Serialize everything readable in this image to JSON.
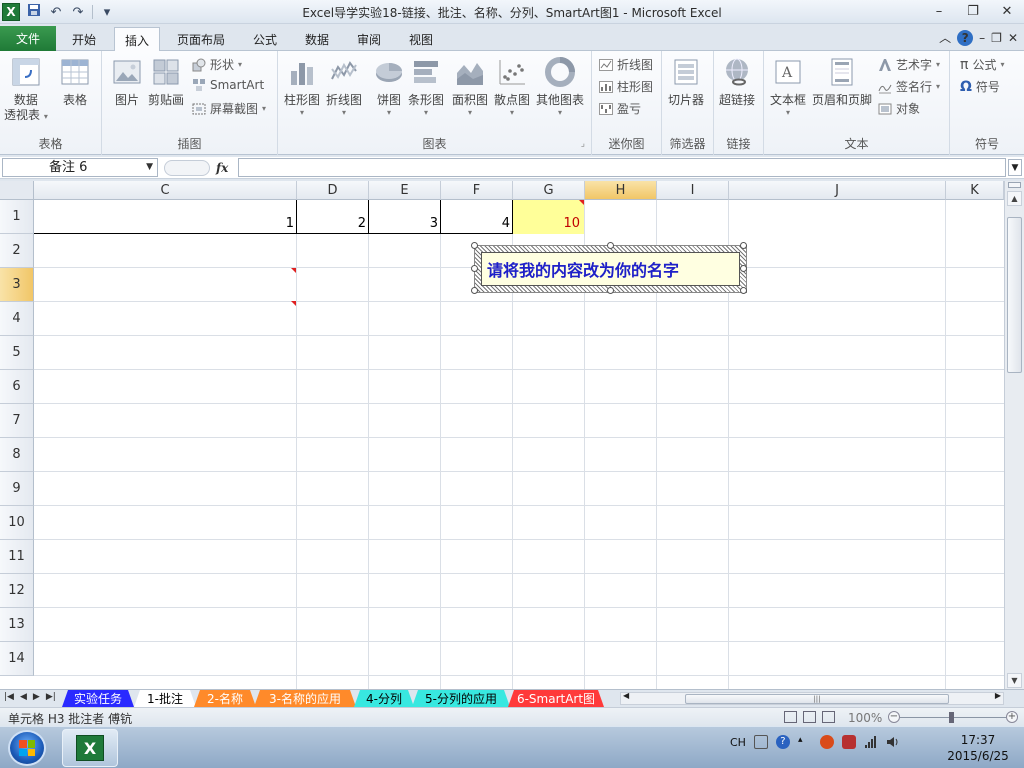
{
  "window": {
    "title": "Excel导学实验18-链接、批注、名称、分列、SmartArt图1 - Microsoft Excel",
    "app_icon": "X"
  },
  "quick_access": {
    "save_icon": "save-icon",
    "undo_icon": "undo-icon",
    "redo_icon": "redo-icon",
    "customize_icon": "customize-icon"
  },
  "ribbon_tabs": {
    "file": "文件",
    "items": [
      "开始",
      "插入",
      "页面布局",
      "公式",
      "数据",
      "审阅",
      "视图"
    ],
    "active": "插入"
  },
  "ribbon": {
    "groups": {
      "tables": "表格",
      "illustrations": "插图",
      "charts": "图表",
      "sparklines": "迷你图",
      "filter": "筛选器",
      "links": "链接",
      "text": "文本",
      "symbols": "符号"
    },
    "buttons": {
      "pivot_line1": "数据",
      "pivot_line2": "透视表",
      "table": "表格",
      "picture": "图片",
      "clipart": "剪贴画",
      "shapes": "形状",
      "smartart": "SmartArt",
      "screenshot": "屏幕截图",
      "column": "柱形图",
      "line": "折线图",
      "pie": "饼图",
      "bar": "条形图",
      "area": "面积图",
      "scatter": "散点图",
      "other": "其他图表",
      "spark_line": "折线图",
      "spark_column": "柱形图",
      "spark_winloss": "盈亏",
      "slicer": "切片器",
      "hyperlink": "超链接",
      "textbox": "文本框",
      "header_footer": "页眉和页脚",
      "wordart": "艺术字",
      "signature": "签名行",
      "object": "对象",
      "equation": "公式",
      "symbol": "符号",
      "equation_glyph": "π",
      "symbol_glyph": "Ω"
    }
  },
  "formula_bar": {
    "name_box": "备注 6",
    "fx_label": "fx",
    "value": ""
  },
  "columns": [
    "C",
    "D",
    "E",
    "F",
    "G",
    "H",
    "I",
    "J",
    "K"
  ],
  "rows": [
    "1",
    "2",
    "3",
    "4",
    "5",
    "6",
    "7",
    "8",
    "9",
    "10",
    "11",
    "12",
    "13",
    "14"
  ],
  "cells": {
    "C1": "1",
    "D1": "2",
    "E1": "3",
    "F1": "4",
    "G1": "10"
  },
  "colors": {
    "g1_fill": "#ffff99",
    "g1_text": "#c00000",
    "comment_text": "#1e20c8",
    "comment_flag": "#e02020"
  },
  "comment": {
    "text": "请将我的内容改为你的名字"
  },
  "sheet_tabs": [
    {
      "label": "实验任务",
      "bg": "#2a2aff",
      "fg": "#ffffff"
    },
    {
      "label": "1-批注",
      "bg": "#ffffff",
      "fg": "#000000"
    },
    {
      "label": "2-名称",
      "bg": "#ff8a2a",
      "fg": "#ffffff"
    },
    {
      "label": "3-名称的应用",
      "bg": "#ff8a2a",
      "fg": "#ffffff"
    },
    {
      "label": "4-分列",
      "bg": "#38e8e0",
      "fg": "#000000"
    },
    {
      "label": "5-分列的应用",
      "bg": "#38e8e0",
      "fg": "#000000"
    },
    {
      "label": "6-SmartArt图",
      "bg": "#ff3a3a",
      "fg": "#ffffff"
    }
  ],
  "status": {
    "text": "单元格 H3 批注者 傅钪",
    "zoom": "100%"
  },
  "taskbar": {
    "ime": "CH",
    "time": "17:37",
    "date": "2015/6/25"
  }
}
